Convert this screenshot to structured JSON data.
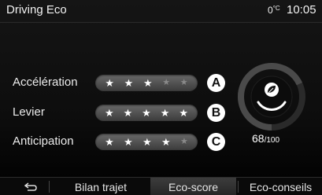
{
  "header": {
    "title": "Driving Eco",
    "temperature": "0",
    "temperature_unit": "°C",
    "time": "10:05"
  },
  "rows": [
    {
      "label": "Accélération",
      "badge": "A",
      "rating": 3,
      "max": 5
    },
    {
      "label": "Levier",
      "badge": "B",
      "rating": 5,
      "max": 5
    },
    {
      "label": "Anticipation",
      "badge": "C",
      "rating": 4,
      "max": 5
    }
  ],
  "score": {
    "value": "68",
    "denominator": "/100",
    "icon": "leaf-icon"
  },
  "tabs": {
    "back_icon": "back-arrow-icon",
    "items": [
      {
        "label": "Bilan trajet",
        "active": false
      },
      {
        "label": "Eco-score",
        "active": true
      },
      {
        "label": "Eco-conseils",
        "active": false
      }
    ]
  },
  "colors": {
    "background": "#000000",
    "star_on": "#ffffff",
    "star_off": "#8a8a8a",
    "badge_bg": "#ffffff"
  }
}
